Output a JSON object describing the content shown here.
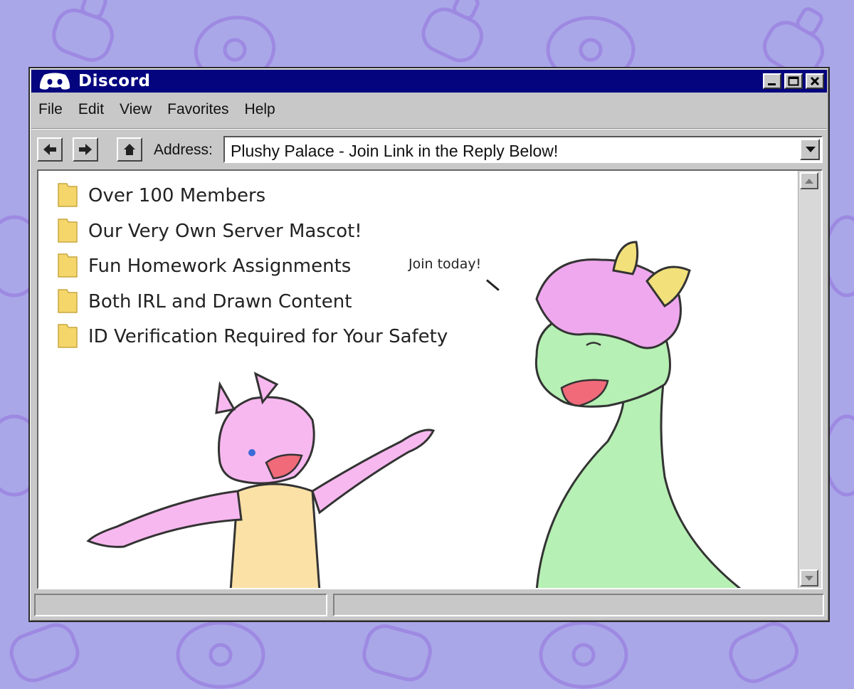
{
  "window": {
    "title": "Discord",
    "icons": {
      "logo": "discord-logo-icon",
      "minimize": "minimize-icon",
      "maximize": "maximize-icon",
      "close": "close-icon"
    }
  },
  "menu": [
    "File",
    "Edit",
    "View",
    "Favorites",
    "Help"
  ],
  "toolbar": {
    "address_label": "Address:",
    "address_value": "Plushy Palace  - Join Link in the Reply Below!",
    "icons": [
      "back-arrow-icon",
      "forward-arrow-icon",
      "home-icon",
      "dropdown-arrow-icon"
    ]
  },
  "content": {
    "items": [
      "Over 100 Members",
      "Our Very Own Server Mascot!",
      "Fun Homework Assignments",
      "Both IRL and Drawn Content",
      "ID Verification Required for Your Safety"
    ],
    "speech": "Join today!"
  },
  "colors": {
    "background": "#a9a7e8",
    "titlebar": "#04047f",
    "chrome": "#c8c8c8",
    "folder": "#f5d66b",
    "pink_character": "#f7b8ef",
    "green_character": "#b6f0b4"
  }
}
